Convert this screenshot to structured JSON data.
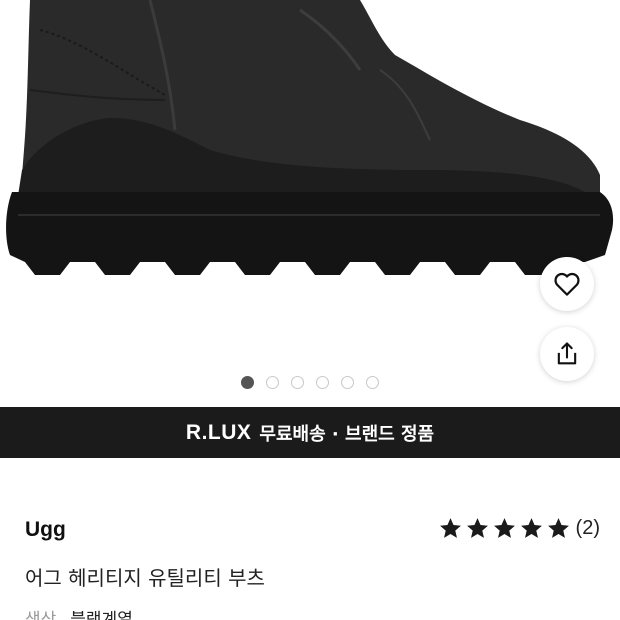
{
  "banner": {
    "brand": "R.LUX",
    "message": "무료배송 · 브랜드 정품"
  },
  "gallery": {
    "slide_count": 6,
    "active_index": 0
  },
  "actions": {
    "wishlist_icon": "heart-icon",
    "share_icon": "share-icon"
  },
  "product": {
    "brand": "Ugg",
    "name": "어그 헤리티지 유틸리티 부츠",
    "rating_stars": 5,
    "review_count": "(2)",
    "color_label": "색상",
    "color_value": "블랙계열"
  },
  "colors": {
    "banner_bg": "#1b1b1b",
    "active_dot": "#555555",
    "star": "#1a1a1a"
  }
}
